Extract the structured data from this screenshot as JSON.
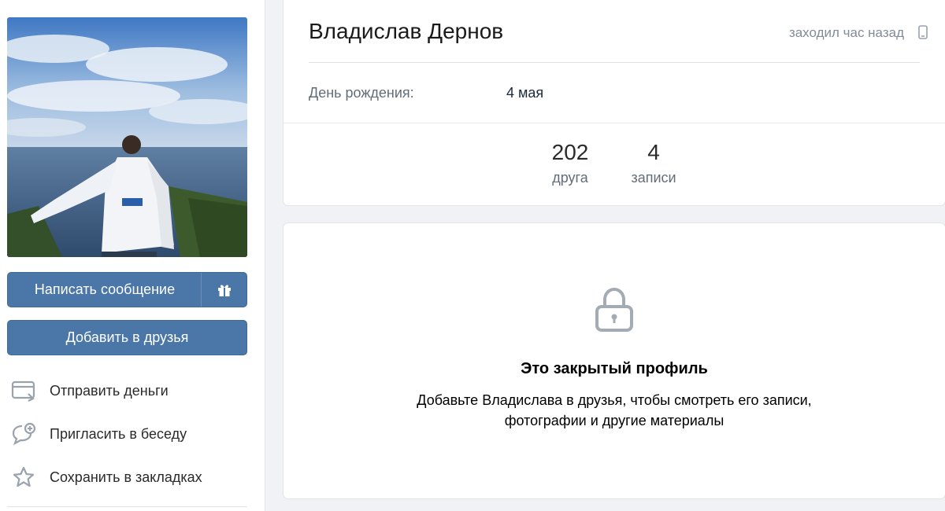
{
  "profile": {
    "name": "Владислав Дернов",
    "online_status": "заходил час назад",
    "birthday_label": "День рождения:",
    "birthday_value": "4 мая"
  },
  "stats": [
    {
      "value": "202",
      "label": "друга"
    },
    {
      "value": "4",
      "label": "записи"
    }
  ],
  "buttons": {
    "message": "Написать сообщение",
    "add_friend": "Добавить в друзья"
  },
  "actions": [
    {
      "label": "Отправить деньги",
      "icon": "card-icon"
    },
    {
      "label": "Пригласить в беседу",
      "icon": "chat-plus-icon"
    },
    {
      "label": "Сохранить в закладках",
      "icon": "star-icon"
    }
  ],
  "private_profile": {
    "title": "Это закрытый профиль",
    "text_line1": "Добавьте Владислава в друзья, чтобы смотреть его записи,",
    "text_line2": "фотографии и другие материалы"
  },
  "colors": {
    "button_blue": "#4a76a8",
    "muted_text": "#818c99",
    "background": "#f0f2f5"
  }
}
